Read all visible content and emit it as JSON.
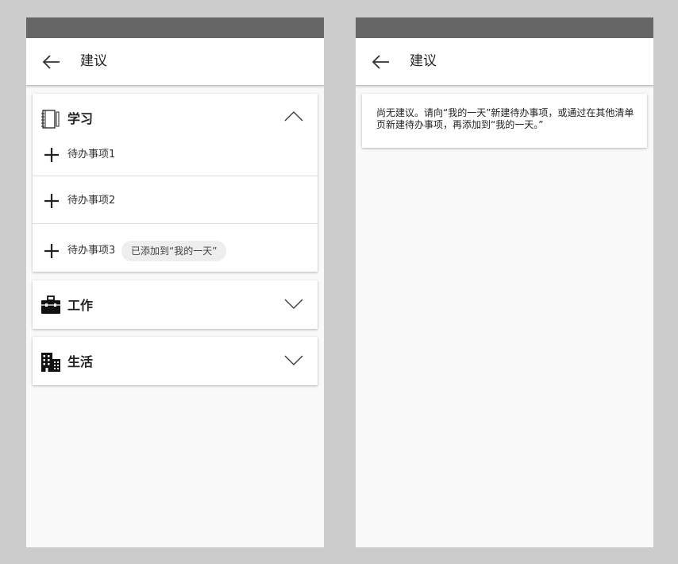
{
  "left_screen": {
    "header": {
      "title": "建议",
      "back_icon": "arrow-left-icon"
    },
    "categories": [
      {
        "title": "学习",
        "icon": "notebook-icon",
        "expanded": true,
        "tasks": [
          {
            "label": "待办事项1",
            "add_icon": "plus-icon"
          },
          {
            "label": "待办事项2",
            "add_icon": "plus-icon"
          },
          {
            "label": "待办事项3",
            "add_icon": "plus-icon",
            "badge": "已添加到“我的一天”"
          }
        ]
      },
      {
        "title": "工作",
        "icon": "briefcase-icon",
        "expanded": false
      },
      {
        "title": "生活",
        "icon": "buildings-icon",
        "expanded": false
      }
    ]
  },
  "right_screen": {
    "header": {
      "title": "建议",
      "back_icon": "arrow-left-icon"
    },
    "empty_message": "尚无建议。请向“我的一天”新建待办事项，或通过在其他清单页新建待办事项，再添加到“我的一天。”"
  },
  "colors": {
    "background": "#cccccc",
    "status_bar": "#666666",
    "screen_bg": "#f9f9f9",
    "card_bg": "#ffffff",
    "badge_bg": "#eeeeee"
  }
}
